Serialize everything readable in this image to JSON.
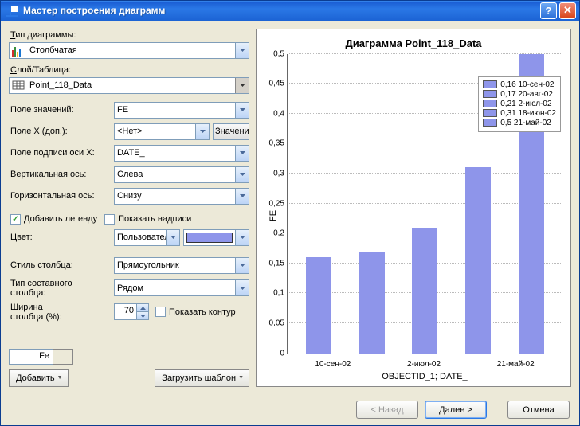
{
  "window": {
    "title": "Мастер построения диаграмм",
    "help": "?",
    "close": "✕"
  },
  "left": {
    "chart_type_label": "Тип диаграммы:",
    "chart_type_value": "Столбчатая",
    "layer_label": "Слой/Таблица:",
    "layer_value": "Point_118_Data",
    "value_field_label": "Поле значений:",
    "value_field_value": "FE",
    "x_field_label": "Поле X (доп.):",
    "x_field_value": "<Нет>",
    "x_field_btn": "Значени",
    "x_axis_label_field_label": "Поле подписи оси X:",
    "x_axis_label_field_value": "DATE_",
    "vertical_axis_label": "Вертикальная ось:",
    "vertical_axis_value": "Слева",
    "horizontal_axis_label": "Горизонтальная ось:",
    "horizontal_axis_value": "Снизу",
    "add_legend_label": "Добавить легенду",
    "show_labels_label": "Показать надписи",
    "color_label": "Цвет:",
    "color_mode_value": "Пользователь",
    "bar_style_label": "Стиль столбца:",
    "bar_style_value": "Прямоугольник",
    "stacked_type_label_l1": "Тип составного",
    "stacked_type_label_l2": "столбца:",
    "stacked_type_value": "Рядом",
    "bar_width_label_l1": "Ширина",
    "bar_width_label_l2": "столбца (%):",
    "bar_width_value": "70",
    "show_outline_label": "Показать контур",
    "series_input": "Fe",
    "add_btn": "Добавить",
    "load_template_btn": "Загрузить шаблон"
  },
  "buttons": {
    "back": "< Назад",
    "next": "Далее >",
    "cancel": "Отмена"
  },
  "chart_data": {
    "type": "bar",
    "title": "Диаграмма  Point_118_Data",
    "categories": [
      "10-сен-02",
      "20-авг-02",
      "2-июл-02",
      "18-июн-02",
      "21-май-02"
    ],
    "values": [
      0.16,
      0.17,
      0.21,
      0.31,
      0.5
    ],
    "ylabel": "FE",
    "xlabel": "OBJECTID_1; DATE_",
    "ylim": [
      0,
      0.5
    ],
    "yticks": [
      0,
      0.05,
      0.1,
      0.15,
      0.2,
      0.25,
      0.3,
      0.35,
      0.4,
      0.45,
      0.5
    ],
    "x_tick_labels": [
      "10-сен-02",
      "2-июл-02",
      "21-май-02"
    ],
    "legend": [
      "0,16 10-сен-02",
      "0,17 20-авг-02",
      "0,21 2-июл-02",
      "0,31 18-июн-02",
      "0,5 21-май-02"
    ]
  }
}
